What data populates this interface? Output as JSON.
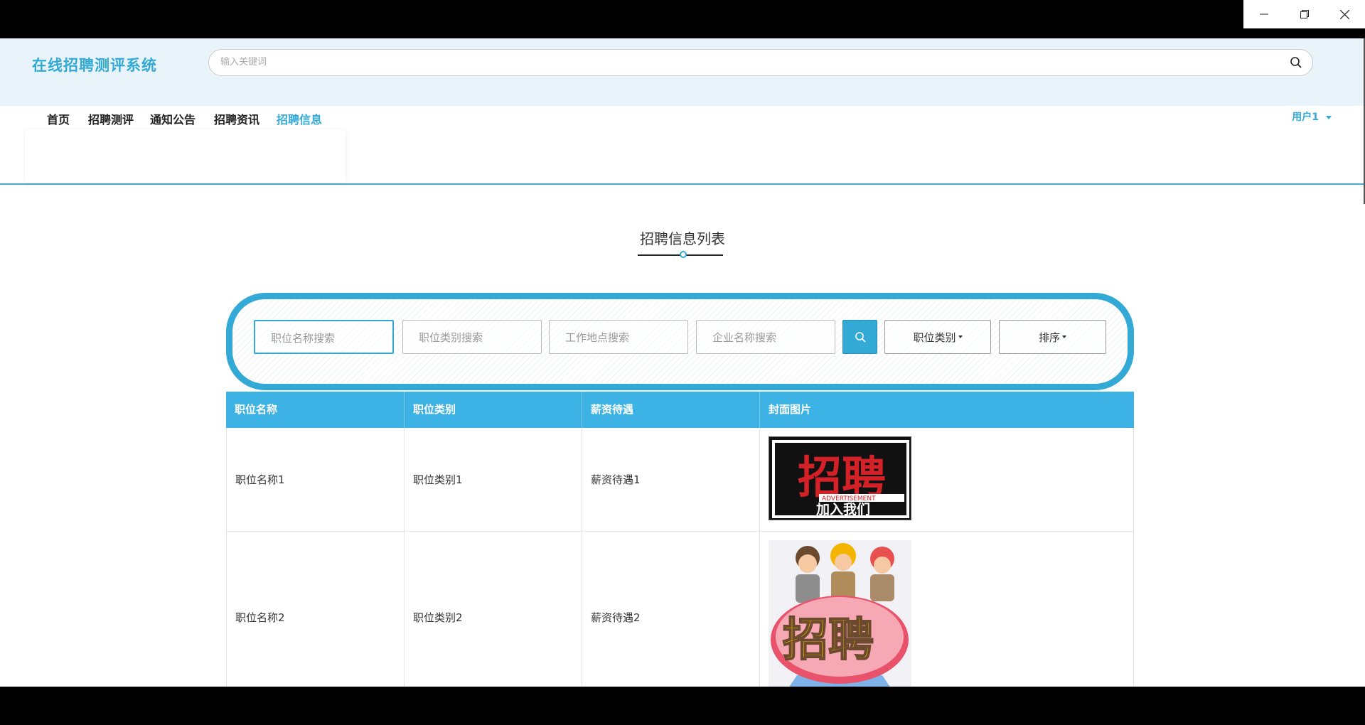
{
  "window": {
    "controls": [
      "minimize",
      "restore",
      "close"
    ]
  },
  "header": {
    "brand": "在线招聘测评系统",
    "search_placeholder": "输入关键词"
  },
  "nav": {
    "items": [
      "首页",
      "招聘测评",
      "通知公告",
      "招聘资讯",
      "招聘信息"
    ],
    "active": "招聘信息",
    "user": "用户1"
  },
  "section": {
    "title": "招聘信息列表"
  },
  "filters": {
    "position_name_placeholder": "职位名称搜索",
    "position_type_placeholder": "职位类别搜索",
    "location_placeholder": "工作地点搜索",
    "company_placeholder": "企业名称搜索",
    "category_dropdown": "职位类别",
    "sort_dropdown": "排序"
  },
  "table": {
    "headers": [
      "职位名称",
      "职位类别",
      "薪资待遇",
      "封面图片"
    ],
    "rows": [
      {
        "name": "职位名称1",
        "type": "职位类别1",
        "salary": "薪资待遇1",
        "cover_text": "招聘",
        "cover_sub": "ADVERTISEMENT",
        "cover_join": "加入我们"
      },
      {
        "name": "职位名称2",
        "type": "职位类别2",
        "salary": "薪资待遇2",
        "cover_text": "招聘"
      }
    ]
  },
  "colors": {
    "accent": "#33a9d6",
    "table_header": "#3db2e4",
    "header_band": "#e8f4f9"
  }
}
